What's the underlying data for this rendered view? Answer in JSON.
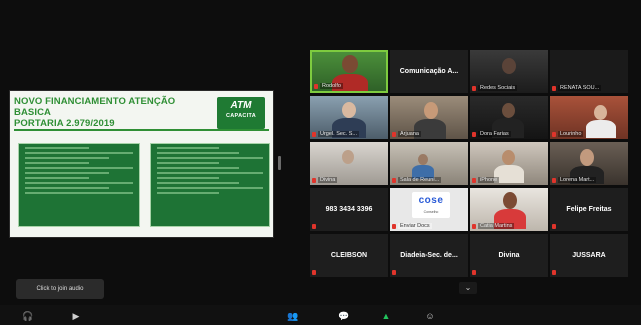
{
  "slide": {
    "title_line1": "NOVO FINANCIAMENTO ATENÇÃO BASICA",
    "title_line2": "PORTARIA 2.979/2019",
    "logo_main": "ATM",
    "logo_sub": "CAPACITA"
  },
  "participants": [
    {
      "name": "Rodolfo",
      "kind": "video",
      "active": true
    },
    {
      "name": "Comunicação A...",
      "kind": "name"
    },
    {
      "name": "Redes Sociais",
      "kind": "video"
    },
    {
      "name": "RENATA SOU...",
      "kind": "video"
    },
    {
      "name": "Urgel. Sec. S...",
      "kind": "video"
    },
    {
      "name": "Arjuana",
      "kind": "video"
    },
    {
      "name": "Dora Farias",
      "kind": "video"
    },
    {
      "name": "Lourinho",
      "kind": "video"
    },
    {
      "name": "Divina",
      "kind": "video"
    },
    {
      "name": "Sala de Reuni...",
      "kind": "video"
    },
    {
      "name": "iPhone",
      "kind": "video"
    },
    {
      "name": "Lorena Mart...",
      "kind": "video"
    },
    {
      "name": "983 3434 3396",
      "kind": "name"
    },
    {
      "name": "Enviar Docs",
      "kind": "video"
    },
    {
      "name": "Catia Martins",
      "kind": "video"
    },
    {
      "name": "Felipe Freitas",
      "kind": "name"
    },
    {
      "name": "CLEIBSON",
      "kind": "name"
    },
    {
      "name": "Diadeia-Sec. de...",
      "kind": "name"
    },
    {
      "name": "Divina",
      "kind": "name"
    },
    {
      "name": "JUSSARA",
      "kind": "name"
    }
  ],
  "cose": {
    "text": "cose",
    "sub": "Conselho"
  },
  "join_audio": "Click to join audio",
  "colors": {
    "accent": "#7ecb3f",
    "mic_muted": "#e0342b",
    "slide_green": "#2f8f35"
  },
  "icons": [
    "headphones-icon",
    "video-off-icon",
    "participants-icon",
    "chat-icon",
    "share-screen-icon",
    "reactions-icon",
    "chevron-down-icon"
  ]
}
